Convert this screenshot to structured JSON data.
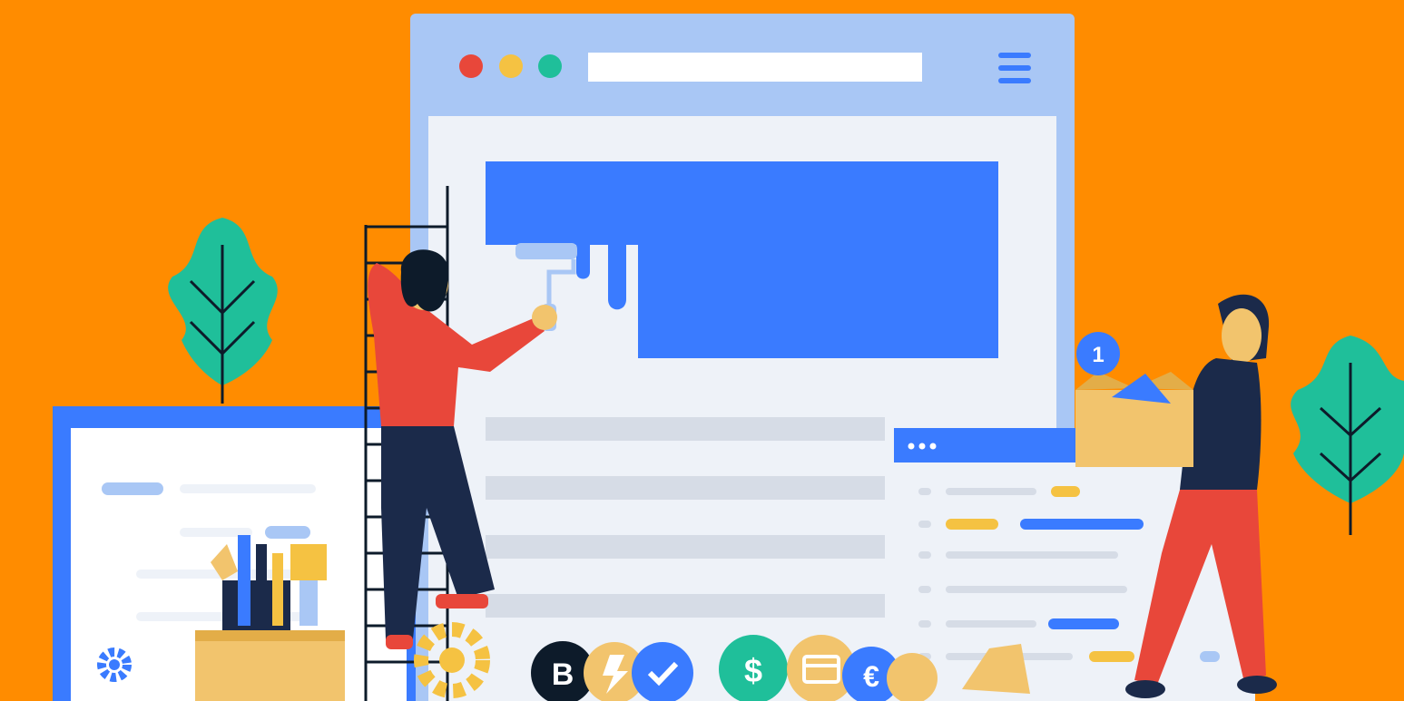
{
  "scene": {
    "background": "#ff8c00",
    "description_icons": [
      "leaf-icon",
      "browser-window-icon",
      "gear-icon",
      "bitcoin-coin-icon",
      "checkmark-coin-icon",
      "dollar-coin-icon",
      "credit-card-coin-icon",
      "euro-coin-icon",
      "lightning-coin-icon",
      "menu-icon",
      "paint-roller-icon",
      "ladder-icon",
      "cardboard-box-icon",
      "pencil-cup-icon",
      "notification-badge-icon"
    ]
  },
  "colors": {
    "orange": "#ff8c00",
    "blue": "#3a7bff",
    "light_blue": "#a9c7f5",
    "panel": "#eef2f8",
    "line_gray": "#d6dce6",
    "green": "#1fbf9a",
    "red": "#e8473a",
    "yellow": "#f5c242",
    "navy": "#1b2a4a",
    "tan": "#f2c46d"
  },
  "badge": {
    "count": "1"
  },
  "coins": {
    "bitcoin": "B",
    "dollar": "$",
    "euro": "€"
  }
}
